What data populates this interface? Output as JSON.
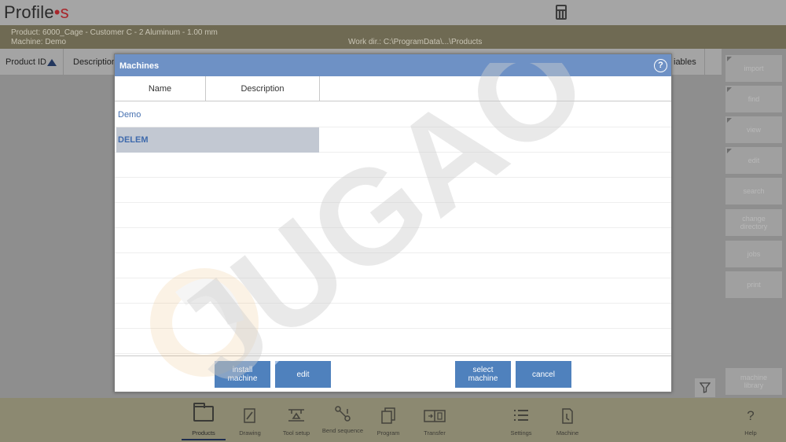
{
  "app": {
    "logo_main": "Profile",
    "logo_dot": "•",
    "logo_s": "s"
  },
  "infobar": {
    "product": "Product: 6000_Cage - Customer C - 2 Aluminum - 1.00 mm",
    "machine": "Machine: Demo",
    "workdir": "Work dir.: C:\\ProgramData\\...\\Products"
  },
  "table": {
    "col_product_id": "Product ID",
    "col_description": "Description",
    "col_variables": "iables"
  },
  "side_buttons": [
    {
      "label": "import"
    },
    {
      "label": "find"
    },
    {
      "label": "view"
    },
    {
      "label": "edit"
    },
    {
      "label": "search"
    },
    {
      "label": "change directory"
    },
    {
      "label": "jobs"
    },
    {
      "label": "print"
    },
    {
      "label": "machine library"
    }
  ],
  "filter_icon": "filter-icon",
  "nav": [
    {
      "label": "Products",
      "icon": "folder-icon",
      "active": true
    },
    {
      "label": "Drawing",
      "icon": "pencil-icon"
    },
    {
      "label": "Tool setup",
      "icon": "tool-setup-icon"
    },
    {
      "label": "Bend sequence",
      "icon": "bend-sequence-icon"
    },
    {
      "label": "Program",
      "icon": "program-icon"
    },
    {
      "label": "Transfer",
      "icon": "transfer-icon"
    },
    {
      "label": "Settings",
      "icon": "list-icon"
    },
    {
      "label": "Machine",
      "icon": "machine-icon"
    },
    {
      "label": "Help",
      "icon": "question-icon"
    }
  ],
  "modal": {
    "title": "Machines",
    "help": "?",
    "columns": [
      "Name",
      "Description"
    ],
    "rows": [
      {
        "name": "Demo",
        "description": ""
      },
      {
        "name": "DELEM",
        "description": "",
        "selected": true
      }
    ],
    "buttons": {
      "install": "install machine",
      "edit": "edit",
      "select": "select machine",
      "cancel": "cancel"
    }
  },
  "watermark": "JUGAO",
  "colors": {
    "title_bar": "#6e91c5",
    "button": "#4f81bd",
    "selected_row": "#c2c8d2",
    "info_bar": "#6f6a53",
    "nav_bar": "#8c8971"
  }
}
